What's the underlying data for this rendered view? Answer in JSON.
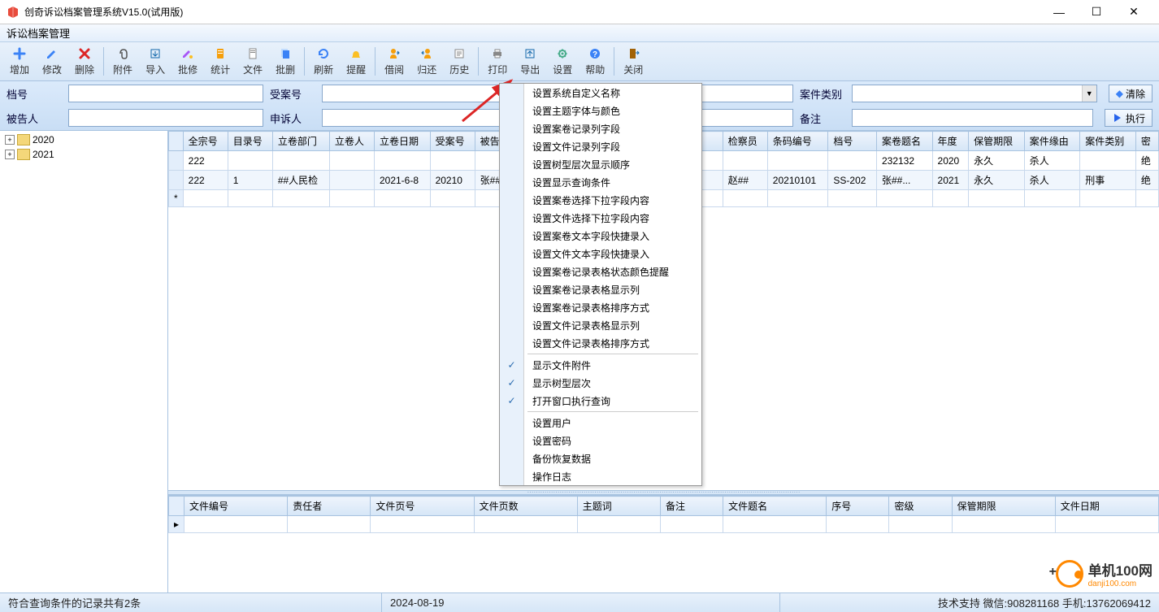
{
  "window": {
    "title": "创奇诉讼档案管理系统V15.0(试用版)",
    "subtitle": "诉讼档案管理"
  },
  "toolbar": {
    "add": "增加",
    "edit": "修改",
    "delete": "删除",
    "attach": "附件",
    "import": "导入",
    "batch_edit": "批修",
    "stats": "统计",
    "file": "文件",
    "batch_del": "批删",
    "refresh": "刷新",
    "remind": "提醒",
    "borrow": "借阅",
    "return": "归还",
    "history": "历史",
    "print": "打印",
    "export": "导出",
    "settings": "设置",
    "help": "帮助",
    "close": "关闭"
  },
  "search": {
    "f1_label": "档号",
    "f2_label": "受案号",
    "f3_label": "案件类别",
    "f4_label": "被告人",
    "f5_label": "申诉人",
    "f6_label": "备注",
    "clear": "清除",
    "exec": "执行"
  },
  "tree": {
    "y2020": "2020",
    "y2021": "2021"
  },
  "table_headers": {
    "quanzong": "全宗号",
    "mulu": "目录号",
    "lijuanbumen": "立卷部门",
    "lijuanren": "立卷人",
    "lijuanriqi": "立卷日期",
    "shouanhao": "受案号",
    "beigaoren": "被告人",
    "jianchayuan": "检察员",
    "tiaoma": "条码编号",
    "danghao": "档号",
    "anjuantiming": "案卷题名",
    "niandu": "年度",
    "baoguan": "保管期限",
    "anjianyuanyou": "案件缘由",
    "anjianleibie": "案件类别",
    "mi": "密"
  },
  "rows": [
    {
      "quanzong": "222",
      "mulu": "",
      "lijuanbumen": "",
      "lijuanren": "",
      "lijuanriqi": "",
      "shouanhao": "",
      "beigaoren": "",
      "jianchayuan": "",
      "tiaoma": "",
      "danghao": "",
      "anjuantiming": "232132",
      "niandu": "2020",
      "baoguan": "永久",
      "anjianyuanyou": "杀人",
      "anjianleibie": "",
      "mi": "绝"
    },
    {
      "quanzong": "222",
      "mulu": "1",
      "lijuanbumen": "##人民检",
      "lijuanren": "",
      "lijuanriqi": "2021-6-8",
      "shouanhao": "20210",
      "beigaoren": "张##",
      "jianchayuan": "赵##",
      "tiaoma": "20210101",
      "danghao": "SS-202",
      "anjuantiming": "张##...",
      "niandu": "2021",
      "baoguan": "永久",
      "anjianyuanyou": "杀人",
      "anjianleibie": "刑事",
      "mi": "绝"
    }
  ],
  "bottom_headers": {
    "wenjianbh": "文件编号",
    "zerenz": "责任者",
    "wenjianyehao": "文件页号",
    "wenjianyeshu": "文件页数",
    "zhutici": "主题词",
    "beizhu": "备注",
    "wenjiantiming": "文件题名",
    "xuhao": "序号",
    "miji": "密级",
    "baoguanqixian": "保管期限",
    "wenjianriqi": "文件日期"
  },
  "menu": {
    "items": [
      "设置系统自定义名称",
      "设置主题字体与颜色",
      "设置案卷记录列字段",
      "设置文件记录列字段",
      "设置树型层次显示顺序",
      "设置显示查询条件",
      "设置案卷选择下拉字段内容",
      "设置文件选择下拉字段内容",
      "设置案卷文本字段快捷录入",
      "设置文件文本字段快捷录入",
      "设置案卷记录表格状态颜色提醒",
      "设置案卷记录表格显示列",
      "设置案卷记录表格排序方式",
      "设置文件记录表格显示列",
      "设置文件记录表格排序方式"
    ],
    "checked": [
      "显示文件附件",
      "显示树型层次",
      "打开窗口执行查询"
    ],
    "admin": [
      "设置用户",
      "设置密码",
      "备份恢复数据",
      "操作日志"
    ]
  },
  "status": {
    "record_count": "符合查询条件的记录共有2条",
    "date": "2024-08-19",
    "support": "技术支持 微信:908281168 手机:13762069412"
  },
  "logo": {
    "cn": "单机100网",
    "en": "danji100.com",
    "plus": "+"
  }
}
